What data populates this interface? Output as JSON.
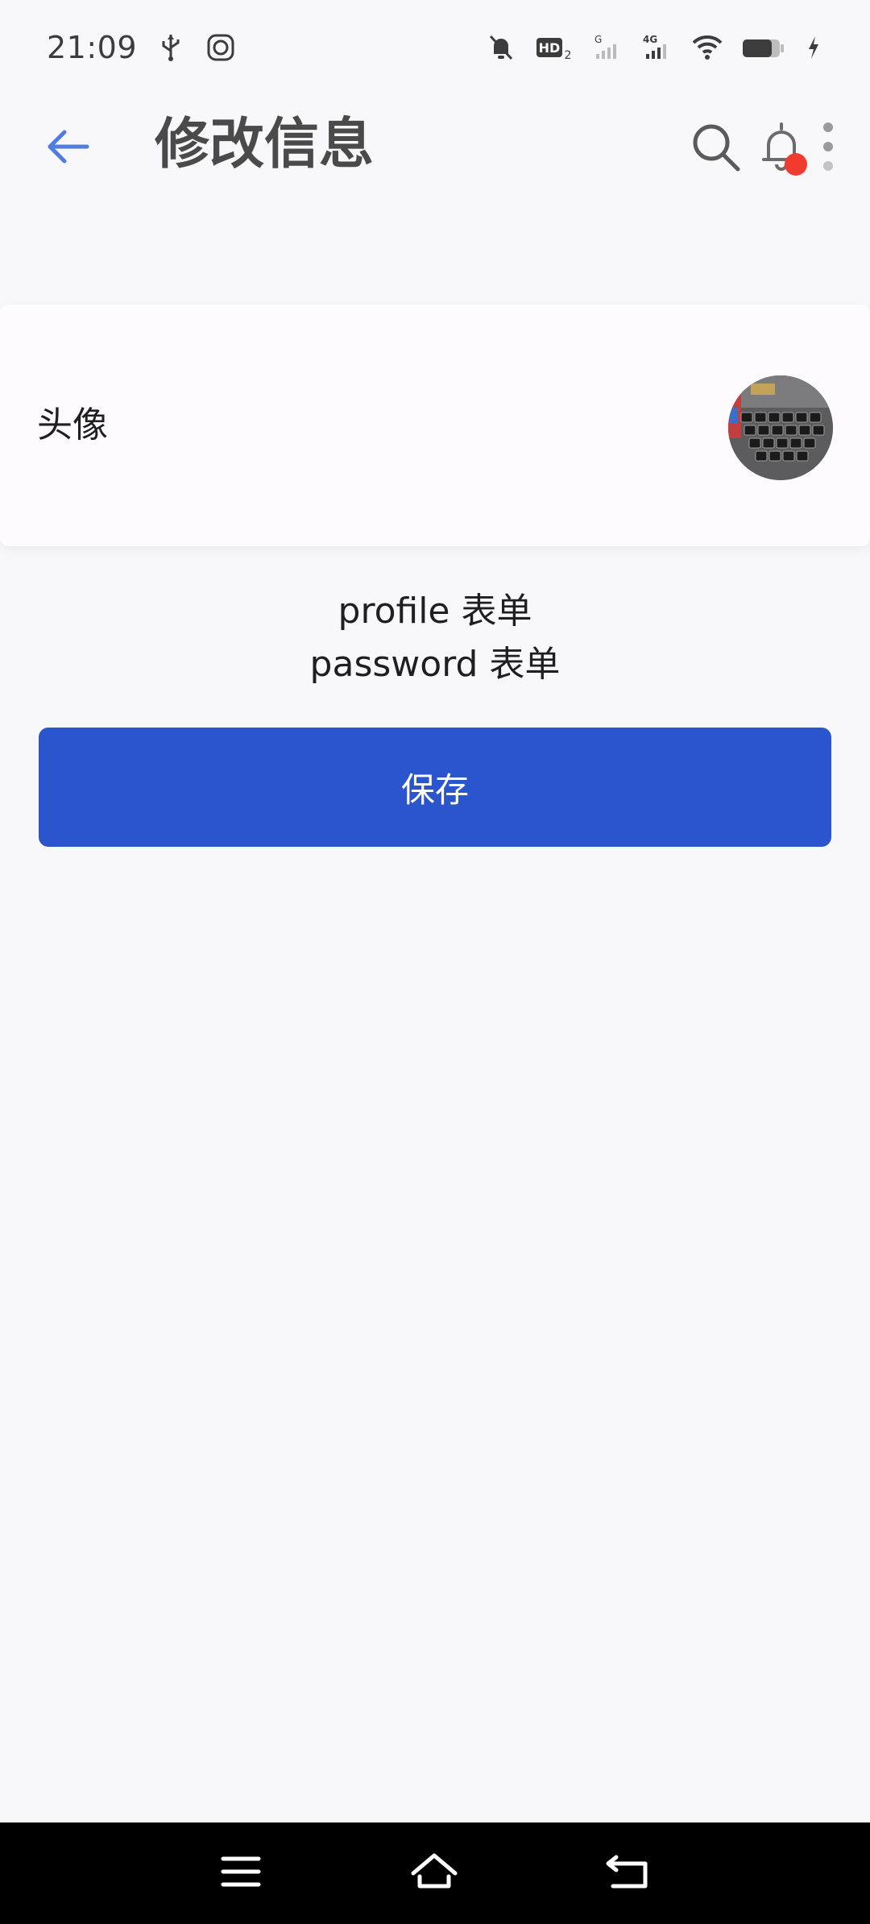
{
  "status_bar": {
    "time": "21:09",
    "left_icons": [
      "usb-icon",
      "app-notification-icon"
    ],
    "right_icons": [
      "silent-bell-icon",
      "hd-icon",
      "signal-g-icon",
      "signal-4g-icon",
      "wifi-icon",
      "battery-icon",
      "charging-icon"
    ],
    "hd_label": "HD",
    "hd_sub": "2",
    "g_label": "G",
    "lte_label": "4G"
  },
  "app_bar": {
    "title": "修改信息",
    "back_icon": "arrow-left-icon",
    "search_icon": "search-icon",
    "bell_icon": "bell-icon",
    "more_icon": "more-vertical-icon",
    "accent_color": "#4f7de0",
    "badge_color": "#f23b2f"
  },
  "avatar_card": {
    "label": "头像",
    "avatar_image": "laptop-keyboard-photo"
  },
  "forms": {
    "profile": "profile 表单",
    "password": "password 表单"
  },
  "save_button": {
    "label": "保存",
    "color": "#2b55cc"
  },
  "nav_bar": {
    "icons": [
      "menu-icon",
      "home-icon",
      "back-icon"
    ]
  }
}
